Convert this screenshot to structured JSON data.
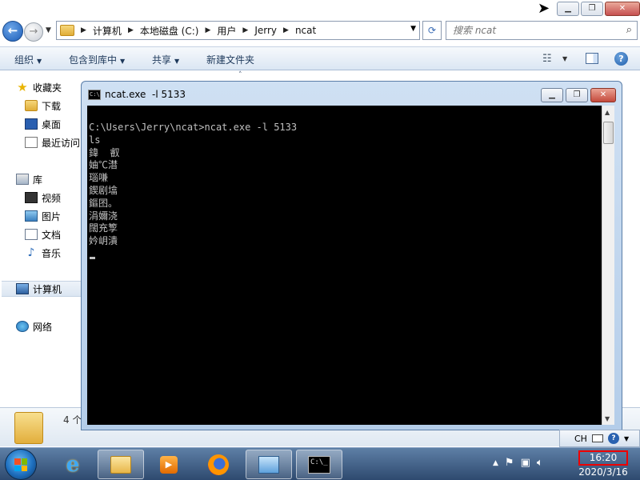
{
  "explorer": {
    "addr": {
      "crumbs": [
        "计算机",
        "本地磁盘 (C:)",
        "用户",
        "Jerry",
        "ncat"
      ],
      "search_placeholder": "搜索 ncat"
    },
    "toolbar": {
      "organize": "组织",
      "include_library": "包含到库中",
      "share": "共享",
      "new_folder": "新建文件夹"
    },
    "nav": {
      "favorites": "收藏夹",
      "downloads": "下载",
      "desktop": "桌面",
      "recent": "最近访问",
      "libraries": "库",
      "videos": "视频",
      "pictures": "图片",
      "documents": "文档",
      "music": "音乐",
      "computer": "计算机",
      "network": "网络"
    },
    "details": {
      "count": "4 个"
    }
  },
  "console": {
    "title": "ncat.exe  -l 5133",
    "lines": [
      "C:\\Users\\Jerry\\ncat>ncat.exe -l 5133",
      "ls",
      "鍏  叡",
      "妯℃澘",
      "瑙嗛",
      "鍥剧墖",
      "鏂囨。",
      "涓嬭浇",
      "闊充箰",
      "妗岄潰"
    ]
  },
  "langbar": {
    "lang": "CH"
  },
  "taskbar": {
    "time": "16:20",
    "date": "2020/3/16"
  },
  "colors": {
    "console_bg": "#000000",
    "console_text": "#c0c0c0",
    "highlight_box": "#e00000"
  },
  "icons": [
    "back-arrow-icon",
    "forward-arrow-icon",
    "folder-icon",
    "refresh-icon",
    "search-icon",
    "help-icon",
    "star-icon",
    "cmd-icon",
    "windows-logo-icon",
    "ie-icon",
    "firefox-icon",
    "volume-icon",
    "network-icon",
    "flag-icon"
  ]
}
